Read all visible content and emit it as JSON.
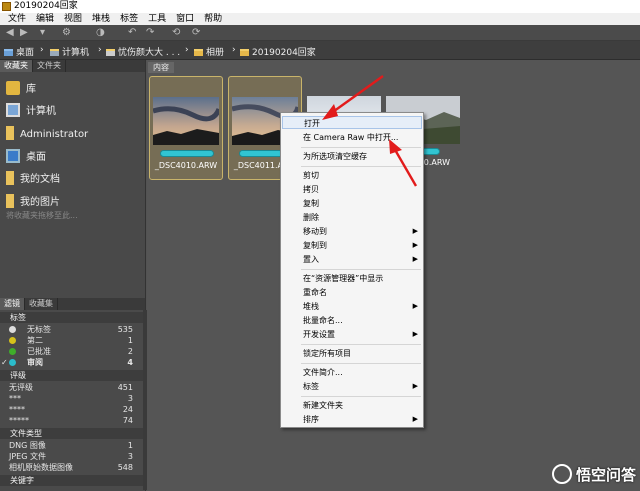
{
  "window": {
    "title": "20190204回家"
  },
  "menubar": [
    "文件",
    "编辑",
    "视图",
    "堆栈",
    "标签",
    "工具",
    "窗口",
    "帮助"
  ],
  "toolbar": {
    "icons": [
      "back-icon",
      "forward-icon",
      "recent-icon",
      "camera-icon",
      "refine-icon",
      "rotate-ccw-icon",
      "rotate-cw-icon"
    ]
  },
  "path": {
    "items": [
      "桌面",
      "计算机",
      "忧伤颜大大 . . .",
      "相册",
      "20190204回家"
    ]
  },
  "favorites_panel": {
    "tabs": [
      "收藏夹",
      "文件夹"
    ],
    "items": [
      {
        "label": "库",
        "icon": "library-icon"
      },
      {
        "label": "计算机",
        "icon": "computer-icon"
      },
      {
        "label": "Administrator",
        "icon": "folder-icon"
      },
      {
        "label": "桌面",
        "icon": "desktop-icon"
      },
      {
        "label": "我的文档",
        "icon": "folder-icon"
      },
      {
        "label": "我的图片",
        "icon": "folder-icon"
      }
    ],
    "hint": "将收藏夹拖移至此..."
  },
  "filter_panel": {
    "tabs": [
      "滤镜",
      "收藏集"
    ],
    "sections": [
      {
        "title": "标签",
        "rows": [
          {
            "label": "无标签",
            "count": "535",
            "color": "#dddddd"
          },
          {
            "label": "第二",
            "count": "1",
            "color": "#d6c21b"
          },
          {
            "label": "已批准",
            "count": "2",
            "color": "#3fae2a"
          },
          {
            "label": "审阅",
            "count": "4",
            "color": "#2bbccb",
            "checked": true
          }
        ]
      },
      {
        "title": "评级",
        "rows": [
          {
            "label": "无评级",
            "count": "451"
          },
          {
            "label": "***",
            "count": "3"
          },
          {
            "label": "****",
            "count": "24"
          },
          {
            "label": "*****",
            "count": "74"
          }
        ]
      },
      {
        "title": "文件类型",
        "rows": [
          {
            "label": "DNG 图像",
            "count": "1"
          },
          {
            "label": "JPEG 文件",
            "count": "3"
          },
          {
            "label": "相机原始数据图像",
            "count": "548"
          }
        ]
      },
      {
        "title": "关键字",
        "rows": []
      }
    ]
  },
  "content": {
    "tab": "内容",
    "thumbnails": [
      {
        "name": "_DSC4010.ARW",
        "selected": true
      },
      {
        "name": "_DSC4011.ARW",
        "selected": true
      },
      {
        "name": "",
        "selected": false
      },
      {
        "name": "0.ARW",
        "selected": false
      }
    ]
  },
  "context_menu": {
    "items": [
      {
        "label": "打开",
        "highlighted": true
      },
      {
        "label": "在 Camera Raw 中打开..."
      },
      {
        "sep": true
      },
      {
        "label": "为所选项清空缓存"
      },
      {
        "sep": true
      },
      {
        "label": "剪切"
      },
      {
        "label": "拷贝"
      },
      {
        "label": "复制"
      },
      {
        "label": "删除"
      },
      {
        "label": "移动到",
        "submenu": true
      },
      {
        "label": "复制到",
        "submenu": true
      },
      {
        "label": "置入",
        "submenu": true
      },
      {
        "sep": true
      },
      {
        "label": "在“资源管理器”中显示"
      },
      {
        "label": "重命名"
      },
      {
        "label": "堆栈",
        "submenu": true
      },
      {
        "label": "批量命名..."
      },
      {
        "label": "开发设置",
        "submenu": true
      },
      {
        "sep": true
      },
      {
        "label": "锁定所有项目"
      },
      {
        "sep": true
      },
      {
        "label": "文件简介..."
      },
      {
        "label": "标签",
        "submenu": true
      },
      {
        "sep": true
      },
      {
        "label": "新建文件夹"
      },
      {
        "label": "排序",
        "submenu": true
      }
    ]
  },
  "colors": {
    "annotation_arrow": "#e21b1b",
    "label_review": "#31c4d2",
    "selection": "#c9b46a"
  },
  "watermark": {
    "text": "悟空问答"
  }
}
